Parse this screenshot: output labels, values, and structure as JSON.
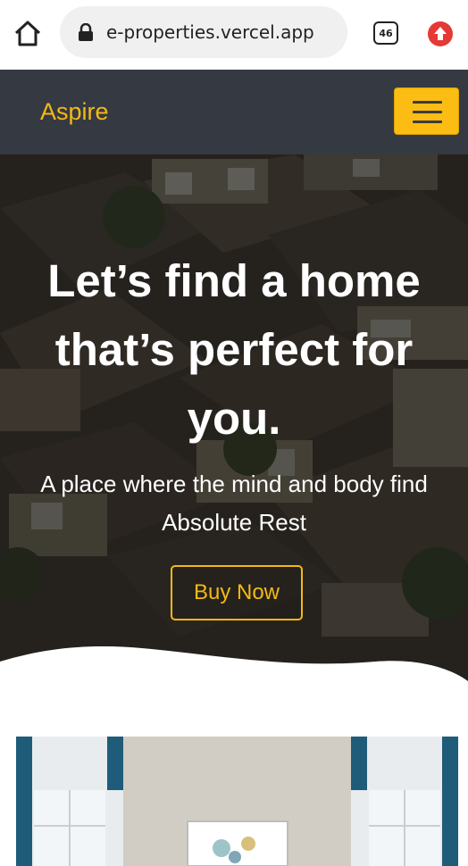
{
  "browser": {
    "url": "e-properties.vercel.app",
    "tab_count": "46",
    "icons": [
      "home-icon",
      "lock-icon",
      "update-arrow-icon"
    ]
  },
  "navbar": {
    "brand": "Aspire",
    "menu_icon": "hamburger-icon",
    "accent_color": "#f5b914",
    "background": "#353942"
  },
  "hero": {
    "title_lines": [
      "Let’s find a home",
      "that’s perfect for",
      "you."
    ],
    "subtitle_lines": [
      "A place where the mind and body find",
      "Absolute Rest"
    ],
    "cta": "Buy Now"
  }
}
